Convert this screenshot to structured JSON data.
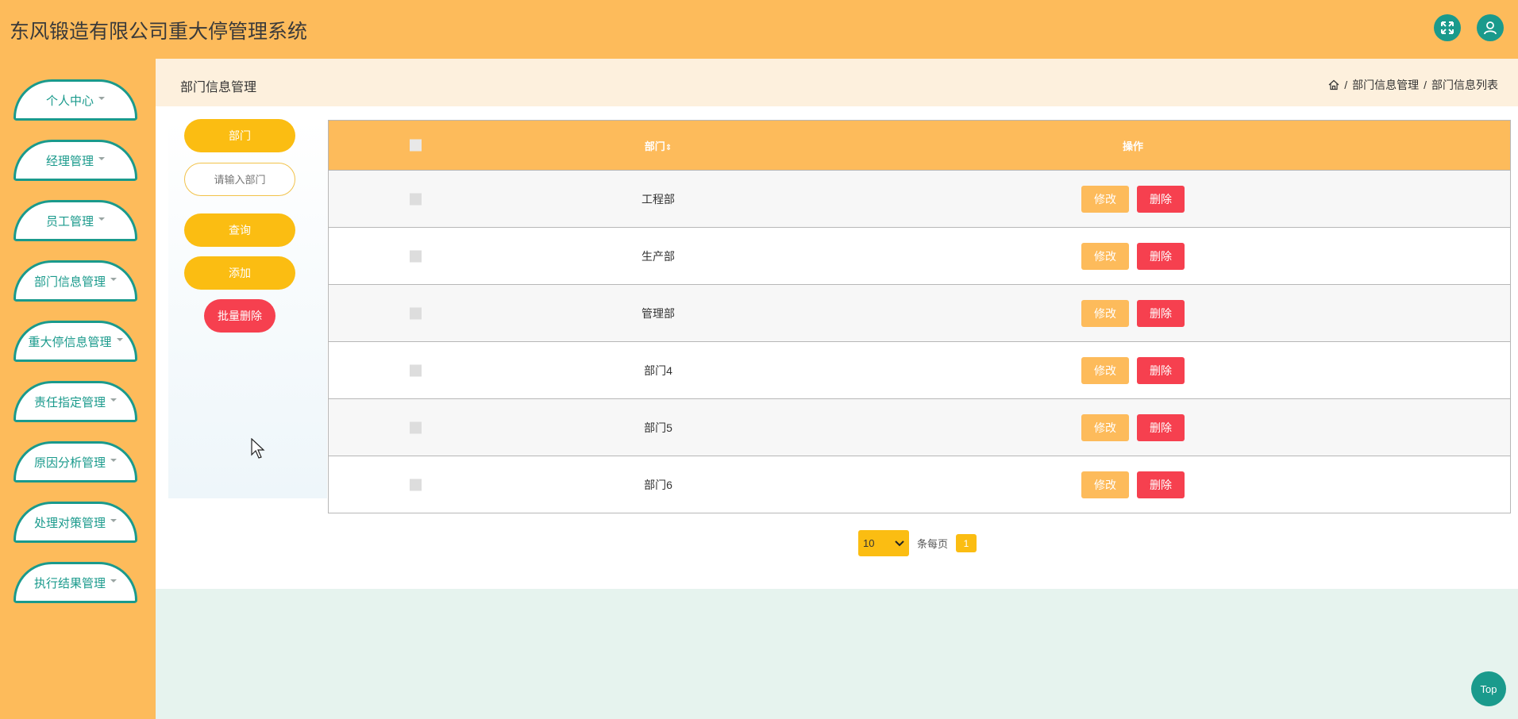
{
  "header": {
    "title": "东风锻造有限公司重大停管理系统",
    "icons": [
      "fullscreen-icon",
      "user-icon"
    ],
    "accent_color": "#fdbb5b",
    "icon_bg_color": "#1a9a8c"
  },
  "sidebar": {
    "items": [
      {
        "label": "个人中心"
      },
      {
        "label": "经理管理"
      },
      {
        "label": "员工管理"
      },
      {
        "label": "部门信息管理"
      },
      {
        "label": "重大停信息管理"
      },
      {
        "label": "责任指定管理"
      },
      {
        "label": "原因分析管理"
      },
      {
        "label": "处理对策管理"
      },
      {
        "label": "执行结果管理"
      }
    ]
  },
  "page": {
    "title": "部门信息管理",
    "breadcrumb": [
      "部门信息管理",
      "部门信息列表"
    ]
  },
  "search": {
    "field_label": "部门",
    "placeholder": "请输入部门",
    "query_label": "查询",
    "add_label": "添加",
    "batch_delete_label": "批量删除"
  },
  "table": {
    "columns": [
      "部门",
      "操作"
    ],
    "rows": [
      {
        "dept": "工程部"
      },
      {
        "dept": "生产部"
      },
      {
        "dept": "管理部"
      },
      {
        "dept": "部门4"
      },
      {
        "dept": "部门5"
      },
      {
        "dept": "部门6"
      }
    ],
    "edit_label": "修改",
    "delete_label": "删除"
  },
  "pagination": {
    "page_size": "10",
    "per_page_text": "条每页",
    "current_page": "1"
  },
  "back_to_top": "Top"
}
